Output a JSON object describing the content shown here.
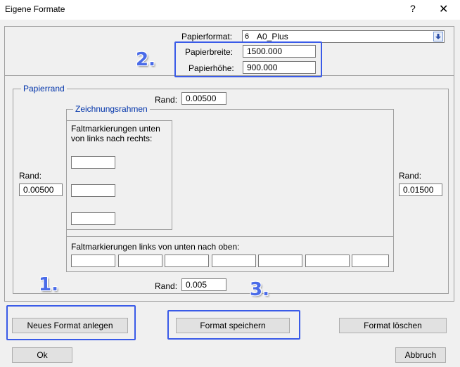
{
  "window": {
    "title": "Eigene Formate",
    "help": "?",
    "close": "✕"
  },
  "format": {
    "papierformat_label": "Papierformat:",
    "papierformat_number": "6",
    "papierformat_value": "A0_Plus",
    "papierbreite_label": "Papierbreite:",
    "papierbreite_value": "1500.000",
    "papierhoehe_label": "Papierhöhe:",
    "papierhoehe_value": "900.000"
  },
  "papierrand": {
    "legend": "Papierrand",
    "top_label": "Rand:",
    "top_value": "0.00500",
    "left_label": "Rand:",
    "left_value": "0.00500",
    "right_label": "Rand:",
    "right_value": "0.01500",
    "bottom_label": "Rand:",
    "bottom_value": "0.005"
  },
  "zeichnungsrahmen": {
    "legend": "Zeichnungsrahmen",
    "fold_left_to_right_line1": "Faltmarkierungen unten",
    "fold_left_to_right_line2": "von links nach rechts:",
    "fold_bottom_to_top": "Faltmarkierungen links von unten nach oben:"
  },
  "buttons": {
    "new_format": "Neues Format anlegen",
    "save_format": "Format speichern",
    "delete_format": "Format löschen",
    "ok": "Ok",
    "cancel": "Abbruch"
  },
  "annotations": {
    "step1": "1.",
    "step2": "2.",
    "step3": "3."
  },
  "colors": {
    "highlight": "#3a5be8",
    "legend_text": "#0033aa",
    "dialog_bg": "#f0f0f0"
  }
}
